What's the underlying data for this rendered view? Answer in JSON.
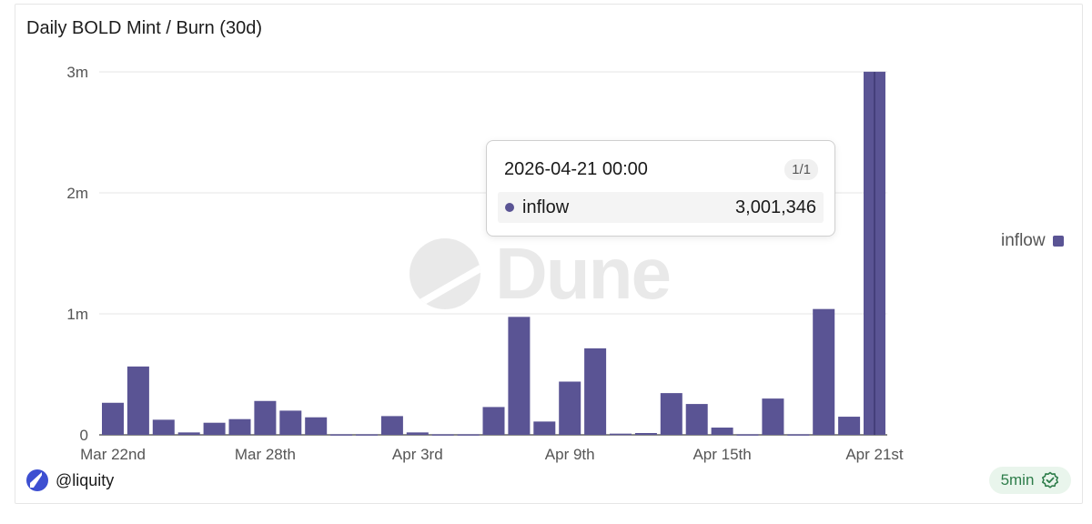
{
  "title": "Daily BOLD Mint / Burn (30d)",
  "legend": {
    "label": "inflow",
    "color": "#5a5494"
  },
  "tooltip": {
    "date": "2026-04-21 00:00",
    "page": "1/1",
    "series": "inflow",
    "value": "3,001,346"
  },
  "footer": {
    "user": "@liquity",
    "refresh": "5min"
  },
  "watermark": "Dune",
  "chart_data": {
    "type": "bar",
    "title": "Daily BOLD Mint / Burn (30d)",
    "xlabel": "",
    "ylabel": "",
    "ylim": [
      0,
      3000000
    ],
    "y_ticks": [
      0,
      1000000,
      2000000,
      3000000
    ],
    "y_tick_labels": [
      "0",
      "1m",
      "2m",
      "3m"
    ],
    "x_tick_labels": [
      {
        "label": "Mar 22nd",
        "index": 0
      },
      {
        "label": "Mar 28th",
        "index": 6
      },
      {
        "label": "Apr 3rd",
        "index": 12
      },
      {
        "label": "Apr 9th",
        "index": 18
      },
      {
        "label": "Apr 15th",
        "index": 24
      },
      {
        "label": "Apr 21st",
        "index": 30
      }
    ],
    "categories": [
      "Mar 22",
      "Mar 23",
      "Mar 24",
      "Mar 25",
      "Mar 26",
      "Mar 27",
      "Mar 28",
      "Mar 29",
      "Mar 30",
      "Mar 31",
      "Apr 1",
      "Apr 2",
      "Apr 3",
      "Apr 4",
      "Apr 5",
      "Apr 6",
      "Apr 7",
      "Apr 8",
      "Apr 9",
      "Apr 10",
      "Apr 11",
      "Apr 12",
      "Apr 13",
      "Apr 14",
      "Apr 15",
      "Apr 16",
      "Apr 17",
      "Apr 18",
      "Apr 19",
      "Apr 20",
      "Apr 21"
    ],
    "series": [
      {
        "name": "inflow",
        "color": "#5a5494",
        "values": [
          265000,
          565000,
          125000,
          20000,
          100000,
          130000,
          280000,
          200000,
          145000,
          5000,
          5000,
          155000,
          20000,
          5000,
          5000,
          230000,
          975000,
          110000,
          440000,
          715000,
          10000,
          15000,
          345000,
          255000,
          60000,
          5000,
          300000,
          5000,
          1040000,
          150000,
          3001346
        ]
      }
    ],
    "grid": true,
    "legend_position": "right"
  }
}
